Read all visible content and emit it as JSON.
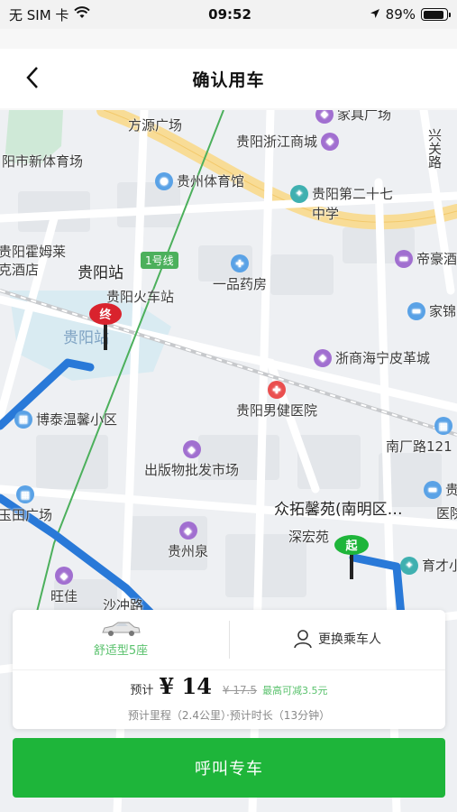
{
  "status_bar": {
    "carrier": "无 SIM 卡",
    "time": "09:52",
    "battery": "89%",
    "battery_level": 0.89
  },
  "nav": {
    "title": "确认用车",
    "back_icon": "chevron-left-icon"
  },
  "map": {
    "pois": [
      {
        "text": "家具广场",
        "icon": "shopping-icon"
      },
      {
        "text": "方源广场",
        "icon": "none"
      },
      {
        "text": "贵阳浙江商城",
        "icon": "shopping-icon"
      },
      {
        "text": "阳市新体育场",
        "icon": "stadium-icon"
      },
      {
        "text": "贵州体育馆",
        "icon": "stadium-icon"
      },
      {
        "text": "贵阳第二十七",
        "icon": "school-icon"
      },
      {
        "text": "中学",
        "icon": "none"
      },
      {
        "text": "贵阳霍姆莱",
        "icon": "hotel-icon"
      },
      {
        "text": "克酒店",
        "icon": "none"
      },
      {
        "text": "贵阳站",
        "icon": "none"
      },
      {
        "text": "贵阳火车站",
        "icon": "none"
      },
      {
        "text": "1号线",
        "icon": "metro-icon"
      },
      {
        "text": "一品药房",
        "icon": "pharmacy-icon"
      },
      {
        "text": "帝豪酒",
        "icon": "hotel-icon"
      },
      {
        "text": "家锦",
        "icon": "hotel-icon"
      },
      {
        "text": "贵阳站",
        "icon": "none"
      },
      {
        "text": "浙商海宁皮革城",
        "icon": "shopping-icon"
      },
      {
        "text": "博泰温馨小区",
        "icon": "residence-icon"
      },
      {
        "text": "贵阳男健医院",
        "icon": "hospital-icon"
      },
      {
        "text": "南厂路121",
        "icon": "residence-icon"
      },
      {
        "text": "出版物批发市场",
        "icon": "shopping-icon"
      },
      {
        "text": "众拓馨苑(南明区…",
        "icon": "none"
      },
      {
        "text": "贵阳",
        "icon": "hotel-icon"
      },
      {
        "text": "医院",
        "icon": "none"
      },
      {
        "text": "玉田广场",
        "icon": "residence-icon"
      },
      {
        "text": "深宏苑",
        "icon": "none"
      },
      {
        "text": "贵州泉",
        "icon": "shopping-icon"
      },
      {
        "text": "育才小",
        "icon": "school-icon"
      },
      {
        "text": "旺佳",
        "icon": "shopping-icon"
      },
      {
        "text": "沙冲路",
        "icon": "none"
      },
      {
        "text": "兴关路",
        "icon": "none"
      }
    ],
    "start_marker": "起",
    "end_marker": "终"
  },
  "panel": {
    "car_type": "舒适型5座",
    "change_passenger": "更换乘车人",
    "price_prefix": "预计",
    "price": "¥ 14",
    "original_price": "¥ 17.5",
    "discount": "最高可减3.5元",
    "estimate": "预计里程（2.4公里）·预计时长（13分钟）"
  },
  "call_button": "呼叫专车",
  "colors": {
    "accent_green": "#1eb53a",
    "route_blue": "#2979d8",
    "metro_green": "#4cb05c",
    "end_red": "#d9232d"
  }
}
